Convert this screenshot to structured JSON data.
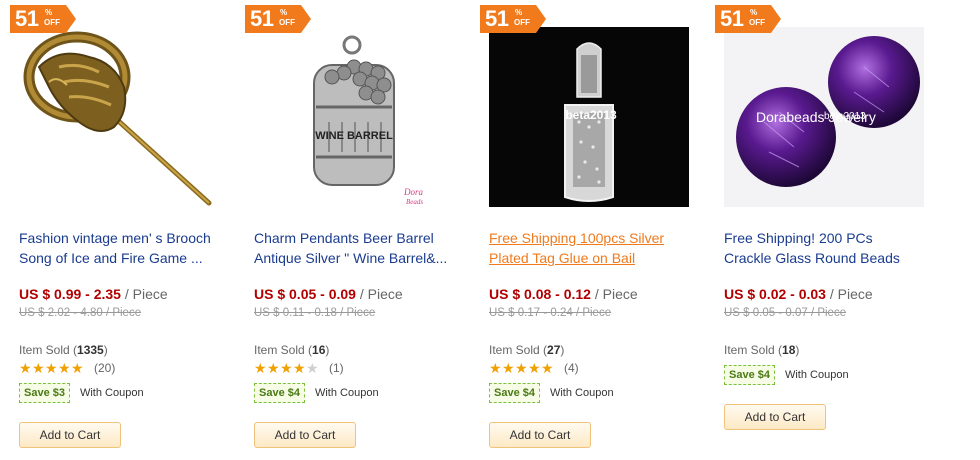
{
  "colors": {
    "accent": "#f07a1c",
    "link": "#1a3c8f",
    "price": "#b20000",
    "coupon": "#7cbf3a"
  },
  "products": [
    {
      "badge": {
        "value": "51",
        "percent": "%",
        "off": "OFF"
      },
      "title_line1": "Fashion vintage men' s Brooch",
      "title_line2": "Song of Ice and Fire Game ...",
      "price": "US $ 0.99 - 2.35",
      "unit": " / Piece",
      "old_price": "US $ 2.02 - 4.80 / Piece",
      "sold_label": "Item Sold (",
      "sold_count": "1335",
      "sold_close": ")",
      "rating": 4.5,
      "reviews": "(20)",
      "coupon": "Save $3",
      "coupon_note": "With Coupon",
      "cart_label": "Add to Cart"
    },
    {
      "badge": {
        "value": "51",
        "percent": "%",
        "off": "OFF"
      },
      "title_line1": "Charm Pendants Beer Barrel",
      "title_line2": "Antique Silver \" Wine Barrel&...",
      "price": "US $ 0.05 - 0.09",
      "unit": " / Piece",
      "old_price": "US $ 0.11 - 0.18 / Piece",
      "sold_label": "Item Sold (",
      "sold_count": "16",
      "sold_close": ")",
      "rating": 4,
      "reviews": "(1)",
      "coupon": "Save $4",
      "coupon_note": "With Coupon",
      "cart_label": "Add to Cart",
      "image_text": {
        "barrel_label": "WINE BARREL",
        "brand": "Dora",
        "brand2": "Beads"
      }
    },
    {
      "badge": {
        "value": "51",
        "percent": "%",
        "off": "OFF"
      },
      "title_line1": "Free Shipping 100pcs Silver",
      "title_line2": "Plated Tag Glue on Bail",
      "price": "US $ 0.08 - 0.12",
      "unit": " / Piece",
      "old_price": "US $ 0.17 - 0.24 / Piece",
      "sold_label": "Item Sold (",
      "sold_count": "27",
      "sold_close": ")",
      "rating": 5,
      "reviews": "(4)",
      "coupon": "Save $4",
      "coupon_note": "With Coupon",
      "cart_label": "Add to Cart",
      "image_text": {
        "watermark": "beta2013"
      }
    },
    {
      "badge": {
        "value": "51",
        "percent": "%",
        "off": "OFF"
      },
      "title_line1": "Free Shipping! 200 PCs",
      "title_line2": "Crackle Glass Round Beads",
      "price": "US $ 0.02 - 0.03",
      "unit": " / Piece",
      "old_price": "US $ 0.05 - 0.07 / Piece",
      "sold_label": "Item Sold (",
      "sold_count": "18",
      "sold_close": ")",
      "coupon": "Save $4",
      "coupon_note": "With Coupon",
      "cart_label": "Add to Cart",
      "image_text": {
        "watermark": "Dorabeads Jewelry",
        "watermark2": "beta2013"
      }
    }
  ]
}
